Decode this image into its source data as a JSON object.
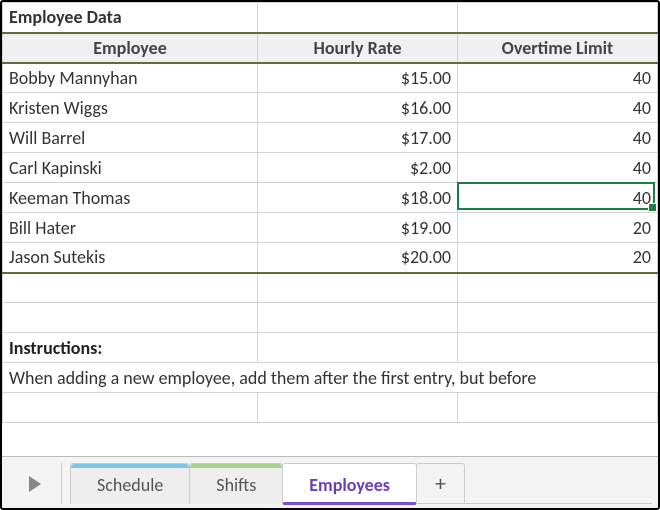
{
  "title": "Employee Data",
  "headers": {
    "a": "Employee",
    "b": "Hourly Rate",
    "c": "Overtime Limit"
  },
  "rows": [
    {
      "name": "Bobby Mannyhan",
      "rate": "$15.00",
      "ot": "40"
    },
    {
      "name": "Kristen Wiggs",
      "rate": "$16.00",
      "ot": "40"
    },
    {
      "name": "Will Barrel",
      "rate": "$17.00",
      "ot": "40"
    },
    {
      "name": "Carl Kapinski",
      "rate": "$2.00",
      "ot": "40"
    },
    {
      "name": "Keeman Thomas",
      "rate": "$18.00",
      "ot": "40"
    },
    {
      "name": "Bill Hater",
      "rate": "$19.00",
      "ot": "20"
    },
    {
      "name": "Jason Sutekis",
      "rate": "$20.00",
      "ot": "20"
    }
  ],
  "instructions_label": "Instructions:",
  "instructions_text": "When adding a new employee, add them after the first entry, but before",
  "tabs": {
    "schedule": {
      "label": "Schedule",
      "accent": "#7ec6e8"
    },
    "shifts": {
      "label": "Shifts",
      "accent": "#a9d18e"
    },
    "employees": {
      "label": "Employees",
      "accent": "#7b4fc9"
    },
    "add": {
      "label": "+"
    }
  },
  "active_tab": "employees",
  "selected_cell": {
    "row_index": 4,
    "col": "c"
  }
}
